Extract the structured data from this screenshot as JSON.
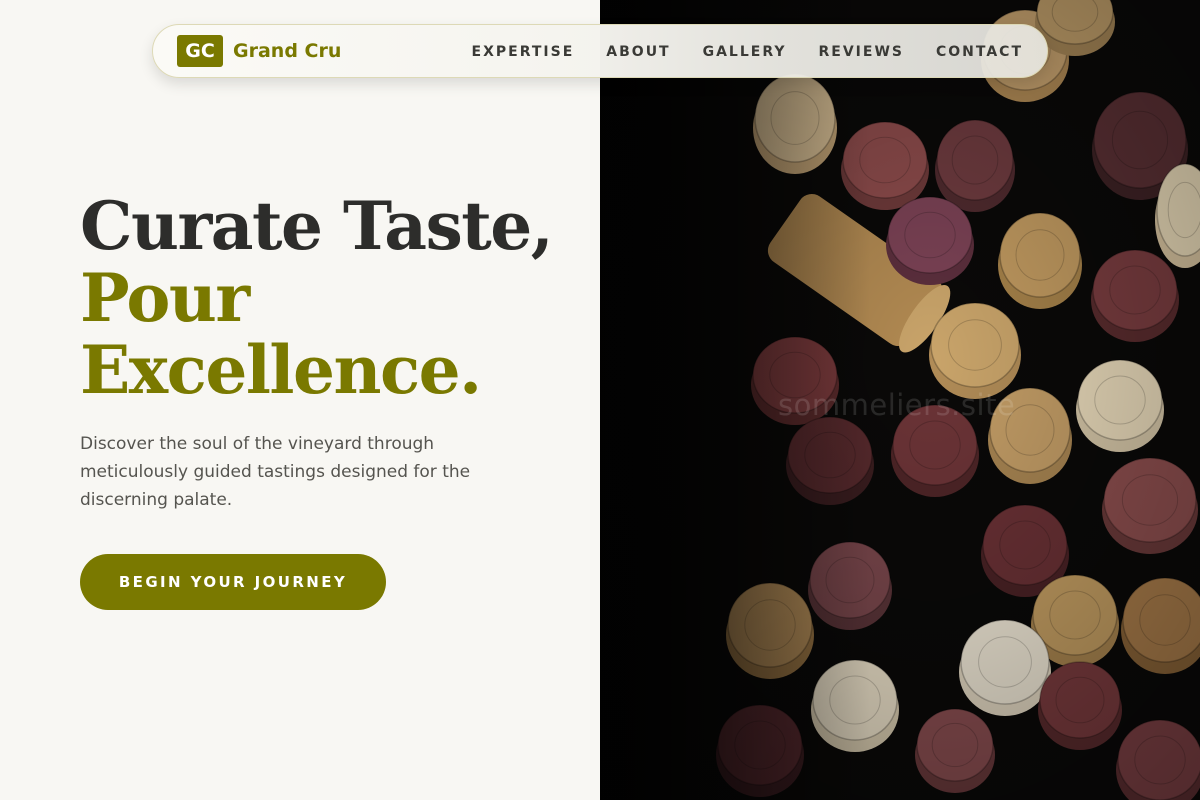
{
  "nav": {
    "logo_mark": "GC",
    "brand_name": "Grand Cru",
    "items": [
      {
        "label": "EXPERTISE"
      },
      {
        "label": "ABOUT"
      },
      {
        "label": "GALLERY"
      },
      {
        "label": "REVIEWS"
      },
      {
        "label": "CONTACT"
      }
    ]
  },
  "hero": {
    "headline_line1": "Curate Taste,",
    "headline_line2": "Pour",
    "headline_line3": "Excellence.",
    "subtext": "Discover the soul of the vineyard through meticulously guided tastings designed for the discerning palate.",
    "cta_label": "BEGIN YOUR JOURNEY"
  },
  "image": {
    "subject": "wine-corks-photo",
    "watermark": "sommeliers.site"
  },
  "colors": {
    "accent": "#7a7900",
    "background": "#f8f7f3",
    "text_dark": "#2d2d2b",
    "photo_bg": "#0a0908"
  }
}
